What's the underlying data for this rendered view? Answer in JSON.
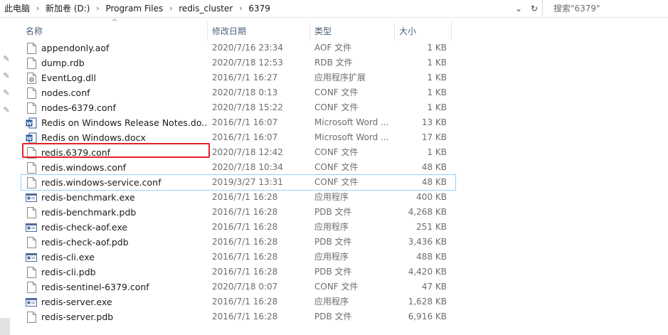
{
  "breadcrumb": [
    "此电脑",
    "新加卷 (D:)",
    "Program Files",
    "redis_cluster",
    "6379"
  ],
  "search": {
    "placeholder": "搜索\"6379\""
  },
  "columns": {
    "name": "名称",
    "date": "修改日期",
    "type": "类型",
    "size": "大小"
  },
  "files": [
    {
      "name": "appendonly.aof",
      "date": "2020/7/16 23:34",
      "type": "AOF 文件",
      "size": "1 KB",
      "icon": "file-icon"
    },
    {
      "name": "dump.rdb",
      "date": "2020/7/18 12:53",
      "type": "RDB 文件",
      "size": "1 KB",
      "icon": "file-icon"
    },
    {
      "name": "EventLog.dll",
      "date": "2016/7/1 16:27",
      "type": "应用程序扩展",
      "size": "1 KB",
      "icon": "dll-icon"
    },
    {
      "name": "nodes.conf",
      "date": "2020/7/18 0:13",
      "type": "CONF 文件",
      "size": "1 KB",
      "icon": "file-icon"
    },
    {
      "name": "nodes-6379.conf",
      "date": "2020/7/18 15:22",
      "type": "CONF 文件",
      "size": "1 KB",
      "icon": "file-icon"
    },
    {
      "name": "Redis on Windows Release Notes.do...",
      "date": "2016/7/1 16:07",
      "type": "Microsoft Word ...",
      "size": "13 KB",
      "icon": "word-icon"
    },
    {
      "name": "Redis on Windows.docx",
      "date": "2016/7/1 16:07",
      "type": "Microsoft Word ...",
      "size": "17 KB",
      "icon": "word-icon"
    },
    {
      "name": "redis.6379.conf",
      "date": "2020/7/18 12:42",
      "type": "CONF 文件",
      "size": "1 KB",
      "icon": "file-icon"
    },
    {
      "name": "redis.windows.conf",
      "date": "2020/7/18 10:34",
      "type": "CONF 文件",
      "size": "48 KB",
      "icon": "file-icon"
    },
    {
      "name": "redis.windows-service.conf",
      "date": "2019/3/27 13:31",
      "type": "CONF 文件",
      "size": "48 KB",
      "icon": "file-icon"
    },
    {
      "name": "redis-benchmark.exe",
      "date": "2016/7/1 16:28",
      "type": "应用程序",
      "size": "400 KB",
      "icon": "exe-icon"
    },
    {
      "name": "redis-benchmark.pdb",
      "date": "2016/7/1 16:28",
      "type": "PDB 文件",
      "size": "4,268 KB",
      "icon": "file-icon"
    },
    {
      "name": "redis-check-aof.exe",
      "date": "2016/7/1 16:28",
      "type": "应用程序",
      "size": "251 KB",
      "icon": "exe-icon"
    },
    {
      "name": "redis-check-aof.pdb",
      "date": "2016/7/1 16:28",
      "type": "PDB 文件",
      "size": "3,436 KB",
      "icon": "file-icon"
    },
    {
      "name": "redis-cli.exe",
      "date": "2016/7/1 16:28",
      "type": "应用程序",
      "size": "488 KB",
      "icon": "exe-icon"
    },
    {
      "name": "redis-cli.pdb",
      "date": "2016/7/1 16:28",
      "type": "PDB 文件",
      "size": "4,420 KB",
      "icon": "file-icon"
    },
    {
      "name": "redis-sentinel-6379.conf",
      "date": "2020/7/18 0:07",
      "type": "CONF 文件",
      "size": "47 KB",
      "icon": "file-icon"
    },
    {
      "name": "redis-server.exe",
      "date": "2016/7/1 16:28",
      "type": "应用程序",
      "size": "1,628 KB",
      "icon": "exe-icon"
    },
    {
      "name": "redis-server.pdb",
      "date": "2016/7/1 16:28",
      "type": "PDB 文件",
      "size": "6,916 KB",
      "icon": "file-icon"
    }
  ],
  "hovered_file": "redis.windows-service.conf",
  "annotated_file": "redis.6379.conf",
  "colors": {
    "highlight": "#e8212a",
    "hover_border": "#99d1ff",
    "header_text": "#4c607a"
  }
}
